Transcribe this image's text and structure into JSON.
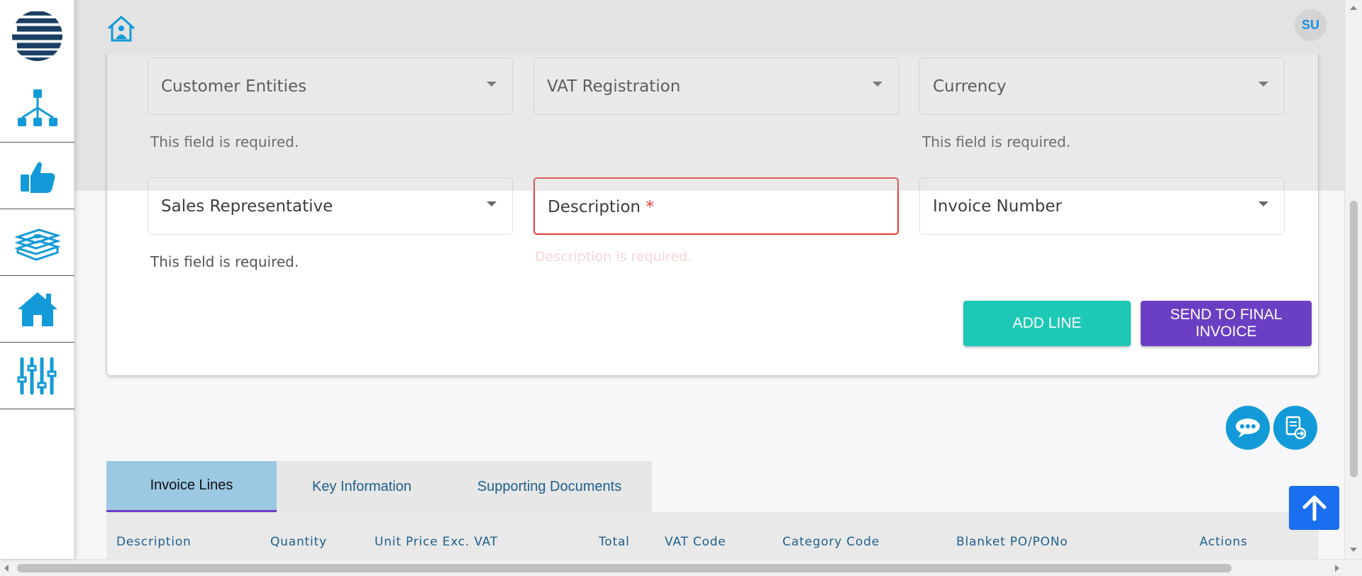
{
  "header": {
    "avatar_initials": "SU"
  },
  "sidebar": {
    "items": [
      {
        "icon": "hierarchy-icon"
      },
      {
        "icon": "thumbs-up-icon"
      },
      {
        "icon": "money-icon"
      },
      {
        "icon": "house-icon"
      },
      {
        "icon": "sliders-icon"
      }
    ]
  },
  "form": {
    "fields": {
      "customer_entities": "Customer Entities",
      "vat_registration": "VAT Registration",
      "currency": "Currency",
      "sales_representative": "Sales Representative",
      "description": "Description",
      "description_required_mark": "*",
      "invoice_number": "Invoice Number"
    },
    "helpers": {
      "customer_entities": "This field is required.",
      "currency": "This field is required.",
      "sales_representative": "This field is required.",
      "description": "Description is required."
    },
    "buttons": {
      "add_line": "ADD LINE",
      "send_final": "SEND TO FINAL INVOICE"
    }
  },
  "tabs": [
    {
      "label": "Invoice Lines",
      "active": true
    },
    {
      "label": "Key Information",
      "active": false
    },
    {
      "label": "Supporting Documents",
      "active": false
    }
  ],
  "table": {
    "columns": [
      "Description",
      "Quantity",
      "Unit Price Exc. VAT",
      "Total",
      "VAT Code",
      "Category Code",
      "Blanket PO/PONo",
      "Actions"
    ]
  },
  "colors": {
    "accent_blue": "#139ad8",
    "teal": "#1ec8b6",
    "purple": "#6b3fc4",
    "error_red": "#e53935"
  }
}
